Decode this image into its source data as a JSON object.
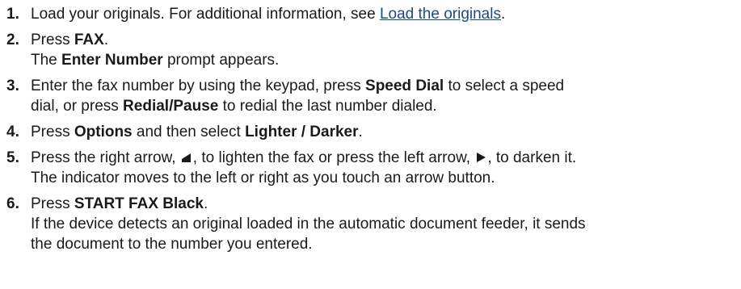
{
  "steps": [
    {
      "number": "1.",
      "text_before_link": "Load your originals. For additional information, see ",
      "link": "Load the originals",
      "text_after_link": "."
    },
    {
      "number": "2.",
      "l1_a": "Press ",
      "l1_bold": "FAX",
      "l1_b": ".",
      "l2_bold": "Enter Number",
      "l2_a": " prompt appears.",
      "l2_prefix": "The "
    },
    {
      "number": "3.",
      "a": "Enter the fax number by using the keypad, press ",
      "bold1": "Speed Dial",
      "b": " to select a speed",
      "c": "dial, or press ",
      "bold2": "Redial/Pause",
      "d": " to redial the last number dialed."
    },
    {
      "number": "4.",
      "a": "Press ",
      "bold1": "Options",
      "b": " and then select ",
      "bold2": "Lighter / Darker",
      "c": "."
    },
    {
      "number": "5.",
      "a": "Press the right arrow, ",
      "b": ", to lighten the fax or press the left arrow, ",
      "c": ", to darken it.",
      "line2": "The indicator moves to the left or right as you touch an arrow button."
    },
    {
      "number": "6.",
      "a": "Press ",
      "bold1": "START FAX Black",
      "b": ".",
      "line2": "If the device detects an original loaded in the automatic document feeder, it sends",
      "line3": "the document to the number you entered."
    }
  ],
  "icons": {
    "right_arrow_icon": "volume-left-triangle-icon",
    "left_arrow_icon": "right-triangle-icon"
  }
}
